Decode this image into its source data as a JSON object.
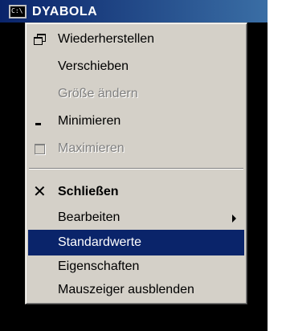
{
  "window": {
    "title": "DYABOLA",
    "icon": "console-icon"
  },
  "menu": {
    "items": [
      {
        "label": "Wiederherstellen",
        "icon": "restore-icon",
        "enabled": true
      },
      {
        "label": "Verschieben",
        "enabled": true
      },
      {
        "label": "Größe ändern",
        "enabled": false
      },
      {
        "label": "Minimieren",
        "icon": "minimize-icon",
        "enabled": true
      },
      {
        "label": "Maximieren",
        "icon": "maximize-icon",
        "enabled": false
      },
      {
        "label": "Schließen",
        "icon": "close-icon",
        "enabled": true,
        "bold": true
      },
      {
        "label": "Bearbeiten",
        "enabled": true,
        "submenu": true
      },
      {
        "label": "Standardwerte",
        "enabled": true,
        "selected": true
      },
      {
        "label": "Eigenschaften",
        "enabled": true
      },
      {
        "label": "Mauszeiger ausblenden",
        "enabled": true
      }
    ]
  },
  "colors": {
    "menu_bg": "#d4d0c8",
    "highlight": "#0a246a",
    "disabled_text": "#808080",
    "console_bg": "#000000"
  }
}
